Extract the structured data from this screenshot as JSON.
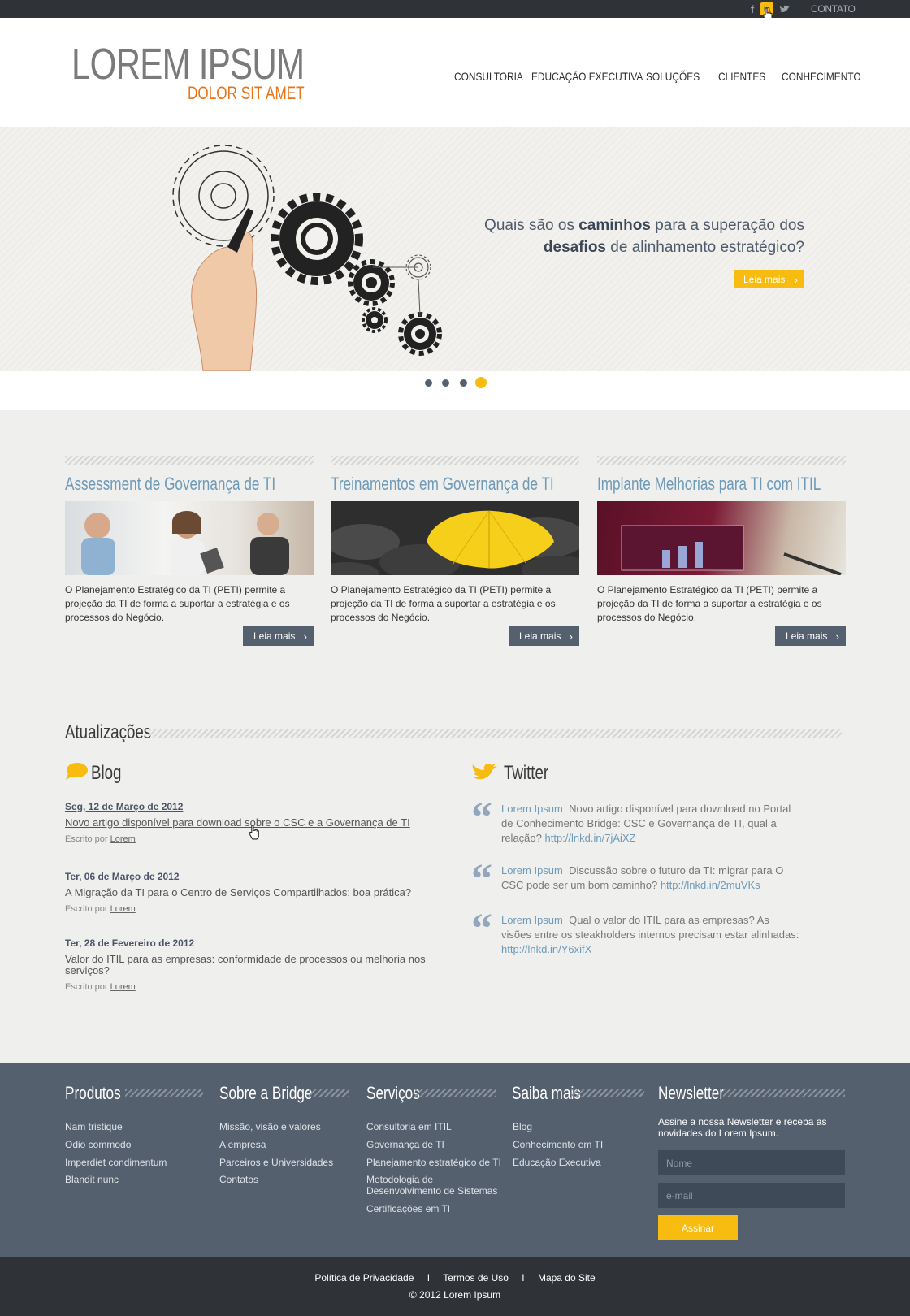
{
  "topbar": {
    "social": [
      {
        "name": "facebook-icon",
        "glyph": "f"
      },
      {
        "name": "linkedin-icon",
        "glyph": "in"
      },
      {
        "name": "twitter-icon",
        "glyph": "t"
      }
    ],
    "contact_label": "CONTATO"
  },
  "header": {
    "logo_main": "LOREM IPSUM",
    "logo_sub": "DOLOR SIT AMET",
    "nav": [
      "CONSULTORIA",
      "EDUCAÇÃO EXECUTIVA",
      "SOLUÇÕES",
      "CLIENTES",
      "CONHECIMENTO"
    ]
  },
  "hero": {
    "text_1": "Quais são os ",
    "text_bold_1": "caminhos",
    "text_2": " para a superação dos",
    "text_bold_2": "desafios",
    "text_3": " de alinhamento estratégico?",
    "button_label": "Leia mais",
    "slide_count": 4,
    "active_slide": 4
  },
  "cards": [
    {
      "title": "Assessment de Governança de TI",
      "text": "O Planejamento Estratégico da TI (PETI) permite a projeção da TI de forma a suportar a estratégia e os processos do Negócio.",
      "button_label": "Leia mais"
    },
    {
      "title": "Treinamentos em Governança de TI",
      "text": "O Planejamento Estratégico da TI (PETI) permite a projeção da TI de forma a suportar a estratégia e os processos do Negócio.",
      "button_label": "Leia mais"
    },
    {
      "title": "Implante Melhorias para TI com ITIL",
      "text": "O Planejamento Estratégico da TI (PETI) permite a projeção da TI de forma a suportar a estratégia e os processos do Negócio.",
      "button_label": "Leia mais"
    }
  ],
  "updates": {
    "title": "Atualizações",
    "blog": {
      "title": "Blog",
      "by_label": "Escrito por ",
      "posts": [
        {
          "date": "Seg, 12 de Março de 2012",
          "title": "Novo artigo disponível para download sobre o CSC e a Governança de TI",
          "author": "Lorem"
        },
        {
          "date": "Ter, 06 de Março de 2012",
          "title": "A Migração da TI para o Centro de Serviços Compartilhados: boa prática?",
          "author": "Lorem"
        },
        {
          "date": "Ter, 28 de Fevereiro de 2012",
          "title": "Valor do ITIL para as empresas: conformidade de processos ou melhoria nos serviços?",
          "author": "Lorem"
        }
      ]
    },
    "twitter": {
      "title": "Twitter",
      "tweets": [
        {
          "user": "Lorem Ipsum",
          "text": "Novo artigo disponível para download no Portal de Conhecimento Bridge: CSC e Governança de TI, qual a relação?",
          "link": "http://lnkd.in/7jAiXZ"
        },
        {
          "user": "Lorem Ipsum",
          "text": "Discussão sobre o futuro da TI: migrar para O CSC pode ser um bom caminho?",
          "link": "http://lnkd.in/2muVKs"
        },
        {
          "user": "Lorem Ipsum",
          "text": "Qual o valor do ITIL para as empresas? As visões entre os steakholders internos precisam estar alinhadas:",
          "link": "http://lnkd.in/Y6xifX"
        }
      ]
    }
  },
  "footer": {
    "columns": [
      {
        "title": "Produtos",
        "links": [
          "Nam tristique",
          "Odio commodo",
          "Imperdiet condimentum",
          "Blandit nunc"
        ]
      },
      {
        "title": "Sobre a Bridge",
        "links": [
          "Missão, visão e valores",
          "A empresa",
          "Parceiros e Universidades",
          "Contatos"
        ]
      },
      {
        "title": "Serviços",
        "links": [
          "Consultoria em ITIL",
          "Governança de TI",
          "Planejamento estratégico de TI",
          "Metodologia de Desenvolvimento de Sistemas",
          "Certificações em TI"
        ]
      },
      {
        "title": "Saiba mais",
        "links": [
          "Blog",
          "Conhecimento em TI",
          "Educação Executiva"
        ]
      }
    ],
    "newsletter": {
      "title": "Newsletter",
      "text": "Assine a nossa Newsletter e receba as novidades do Lorem Ipsum.",
      "name_placeholder": "Nome",
      "email_placeholder": "e-mail",
      "button_label": "Assinar"
    }
  },
  "bottom": {
    "links": [
      "Política de Privacidade",
      "Termos de Uso",
      "Mapa do Site"
    ],
    "separator": "I",
    "copyright": "© 2012 Lorem Ipsum"
  },
  "colors": {
    "accent": "#f8bb10",
    "slate": "#55606e",
    "dark": "#2f3237",
    "link_blue": "#6e9ab8",
    "logo_orange": "#e8741a"
  }
}
